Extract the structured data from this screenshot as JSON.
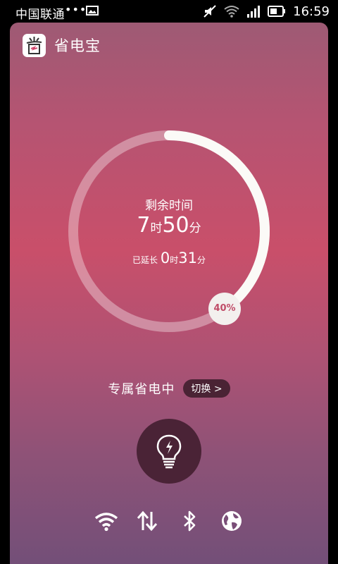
{
  "status_bar": {
    "carrier": "中国联通",
    "dots": "•••",
    "time": "16:59"
  },
  "header": {
    "app_title": "省电宝"
  },
  "battery": {
    "remaining_label": "剩余时间",
    "hours": "7",
    "hour_unit": "时",
    "minutes": "50",
    "minute_unit": "分",
    "extended_label": "已延长",
    "extended_hours": "0",
    "extended_minutes": "31",
    "percent_text": "40%",
    "percent_value": 40
  },
  "mode": {
    "label": "专属省电中",
    "switch_label": "切换 >"
  },
  "toggles": [
    {
      "name": "wifi-icon"
    },
    {
      "name": "mobile-data-icon"
    },
    {
      "name": "bluetooth-icon"
    },
    {
      "name": "globe-icon"
    }
  ],
  "colors": {
    "accent": "#c94f6a",
    "button_dark": "#4a2336"
  }
}
